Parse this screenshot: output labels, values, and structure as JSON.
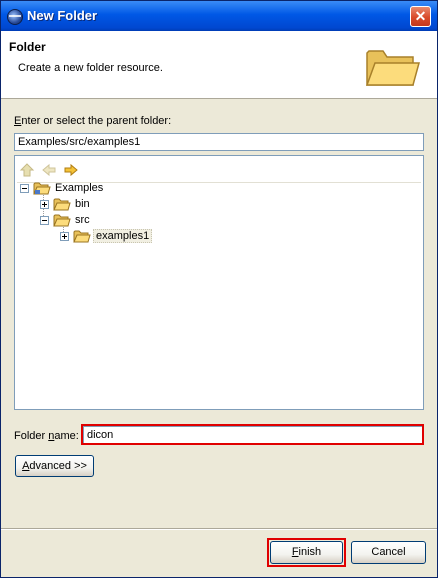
{
  "window": {
    "title": "New Folder",
    "close_icon": "close-icon"
  },
  "header": {
    "title": "Folder",
    "description": "Create a new folder resource.",
    "icon": "folder-icon"
  },
  "parent_folder": {
    "label_pre": "",
    "label_mnemonic": "E",
    "label_post": "nter or select the parent folder:",
    "value": "Examples/src/examples1"
  },
  "tree": {
    "toolbar": [
      "home-icon",
      "back-arrow-icon",
      "forward-arrow-icon"
    ],
    "nodes": [
      {
        "label": "Examples",
        "state": "expanded",
        "icon": "project-folder-icon"
      },
      {
        "label": "bin",
        "state": "collapsed",
        "icon": "folder-icon"
      },
      {
        "label": "src",
        "state": "expanded",
        "icon": "folder-icon"
      },
      {
        "label": "examples1",
        "state": "collapsed",
        "icon": "folder-icon",
        "selected": true
      }
    ]
  },
  "folder_name": {
    "label_pre": "Folder ",
    "label_mnemonic": "n",
    "label_post": "ame:",
    "value": "dicon"
  },
  "advanced": {
    "label_pre": "",
    "label_mnemonic": "A",
    "label_post": "dvanced >>"
  },
  "footer": {
    "finish": {
      "mnemonic": "F",
      "rest": "inish"
    },
    "cancel": "Cancel"
  },
  "colors": {
    "titlebar": "#0058e6",
    "highlight": "#e00000",
    "dialog_bg": "#ece9d8"
  }
}
